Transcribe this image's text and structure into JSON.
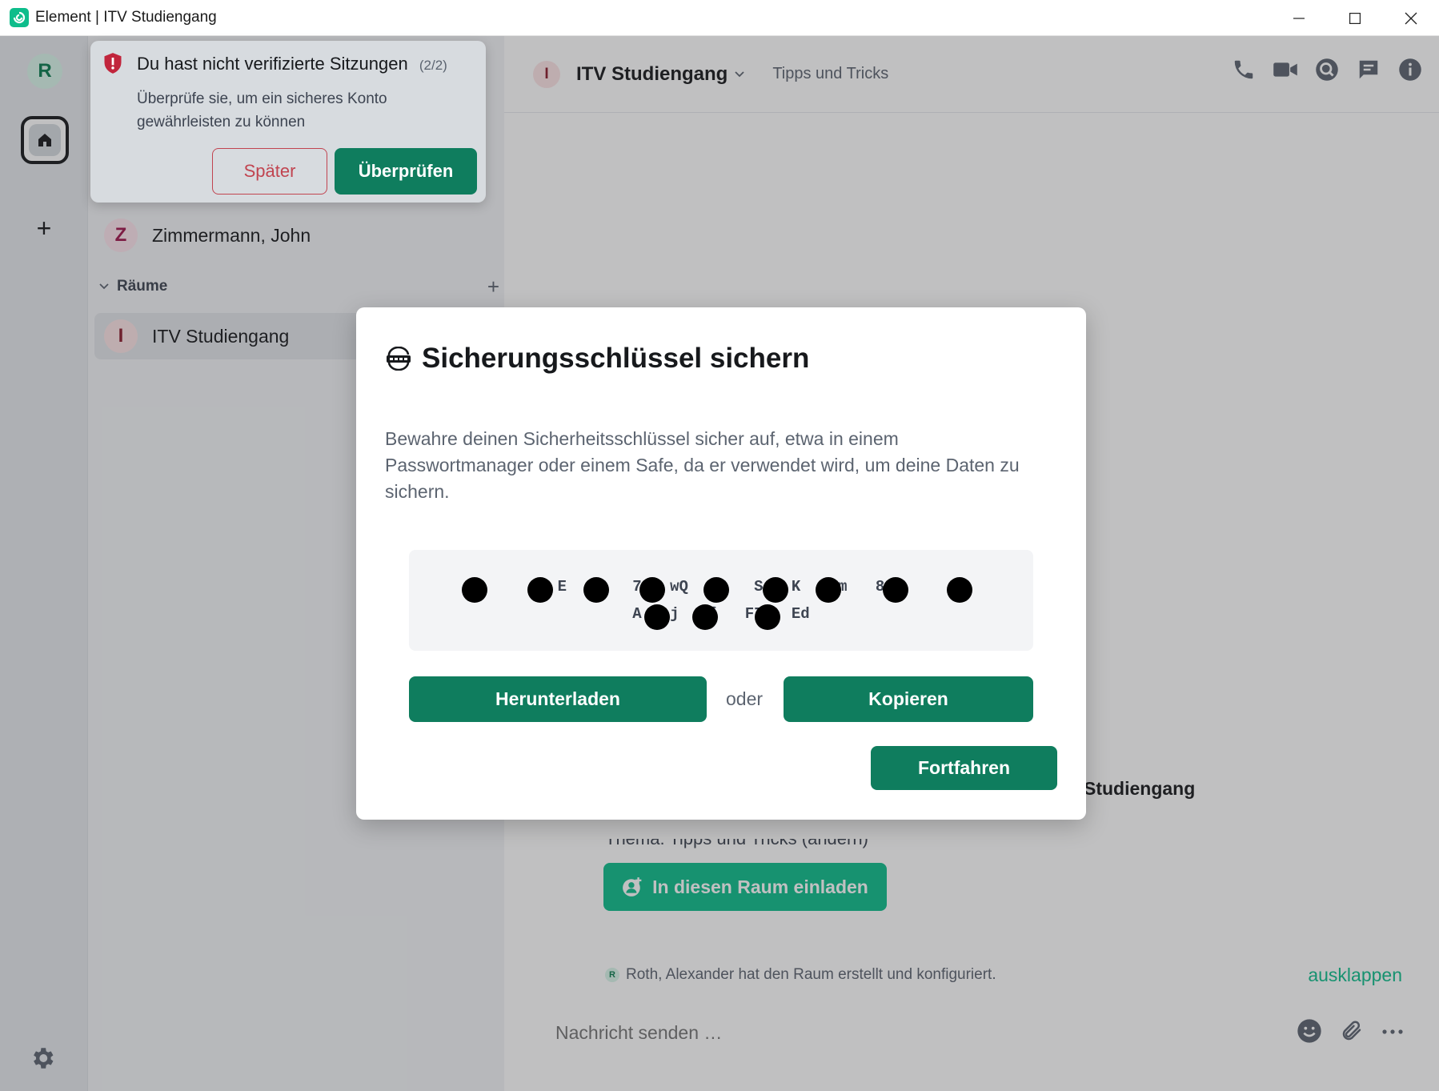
{
  "window": {
    "title": "Element | ITV Studiengang",
    "icon": "element-logo-icon"
  },
  "spaces": {
    "user_initial": "R",
    "home_icon": "home-icon",
    "add_icon": "+",
    "settings_icon": "gear-icon"
  },
  "toast": {
    "title": "Du hast nicht verifizierte Sitzungen",
    "count": "(2/2)",
    "description": "Überprüfe sie, um ein sicheres Konto gewährleisten zu können",
    "later_label": "Später",
    "verify_label": "Überprüfen"
  },
  "roomlist": {
    "dm": {
      "initial": "Z",
      "name": "Zimmermann, John"
    },
    "section_label": "Räume",
    "section_add": "+",
    "rooms": [
      {
        "initial": "I",
        "name": "ITV Studiengang"
      }
    ]
  },
  "room": {
    "avatar_initial": "I",
    "name": "ITV Studiengang",
    "topic": "Tipps und Tricks",
    "header_icons": [
      "phone-icon",
      "video-icon",
      "search-icon",
      "threads-icon",
      "info-icon"
    ],
    "intro_name_fragment": "Studiengang",
    "intro_topic_line": "Thema: Tipps und Tricks (ändern)",
    "invite_label": "In diesen Raum einladen",
    "created_avatar": "R",
    "created_text": "Roth, Alexander hat den Raum erstellt und konfiguriert.",
    "expand_label": "ausklappen",
    "composer_placeholder": "Nachricht senden …",
    "composer_icons": [
      "emoji-icon",
      "attachment-icon",
      "more-icon"
    ]
  },
  "modal": {
    "title": "Sicherungsschlüssel sichern",
    "description": "Bewahre deinen Sicherheitsschlüssel sicher auf, etwa in einem Passwortmanager oder einem Safe, da er verwendet wird, um deine Daten zu sichern.",
    "key_visible": "E 3 7 wQ k S K zm 8 A j f F7 Ed",
    "download_label": "Herunterladen",
    "or_label": "oder",
    "copy_label": "Kopieren",
    "continue_label": "Fortfahren"
  },
  "colors": {
    "accent": "#0dbd8b",
    "button_dark": "#0f7d5e",
    "danger": "#c14450"
  }
}
